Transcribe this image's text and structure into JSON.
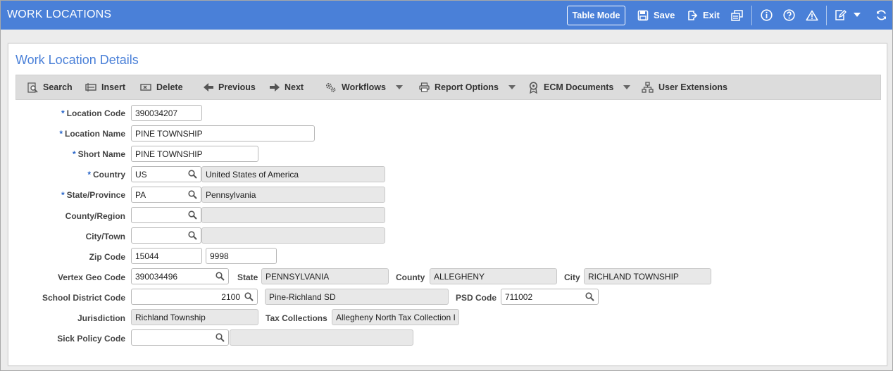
{
  "header": {
    "title": "WORK LOCATIONS",
    "table_mode_label": "Table Mode",
    "save_label": "Save",
    "exit_label": "Exit"
  },
  "panel": {
    "title": "Work Location Details"
  },
  "toolbar": {
    "search": "Search",
    "insert": "Insert",
    "delete": "Delete",
    "previous": "Previous",
    "next": "Next",
    "workflows": "Workflows",
    "report_options": "Report Options",
    "ecm_documents": "ECM Documents",
    "user_extensions": "User Extensions"
  },
  "form": {
    "required_mark": "*",
    "location_code": {
      "label": "Location Code",
      "value": "390034207"
    },
    "location_name": {
      "label": "Location Name",
      "value": "PINE TOWNSHIP"
    },
    "short_name": {
      "label": "Short Name",
      "value": "PINE TOWNSHIP"
    },
    "country": {
      "label": "Country",
      "value": "US",
      "description": "United States of America"
    },
    "state_province": {
      "label": "State/Province",
      "value": "PA",
      "description": "Pennsylvania"
    },
    "county_region": {
      "label": "County/Region",
      "value": "",
      "description": ""
    },
    "city_town": {
      "label": "City/Town",
      "value": "",
      "description": ""
    },
    "zip_code": {
      "label": "Zip Code",
      "value": "15044",
      "extension": "9998"
    },
    "vertex_geo_code": {
      "label": "Vertex Geo Code",
      "value": "390034496",
      "state_label": "State",
      "state_value": "PENNSYLVANIA",
      "county_label": "County",
      "county_value": "ALLEGHENY",
      "city_label": "City",
      "city_value": "RICHLAND TOWNSHIP"
    },
    "school_district_code": {
      "label": "School District Code",
      "value": "2100",
      "description": "Pine-Richland SD",
      "psd_label": "PSD Code",
      "psd_value": "711002"
    },
    "jurisdiction": {
      "label": "Jurisdiction",
      "value": "Richland Township",
      "tax_label": "Tax Collections",
      "tax_value": "Allegheny North Tax Collection I"
    },
    "sick_policy_code": {
      "label": "Sick Policy Code",
      "value": "",
      "description": ""
    }
  }
}
